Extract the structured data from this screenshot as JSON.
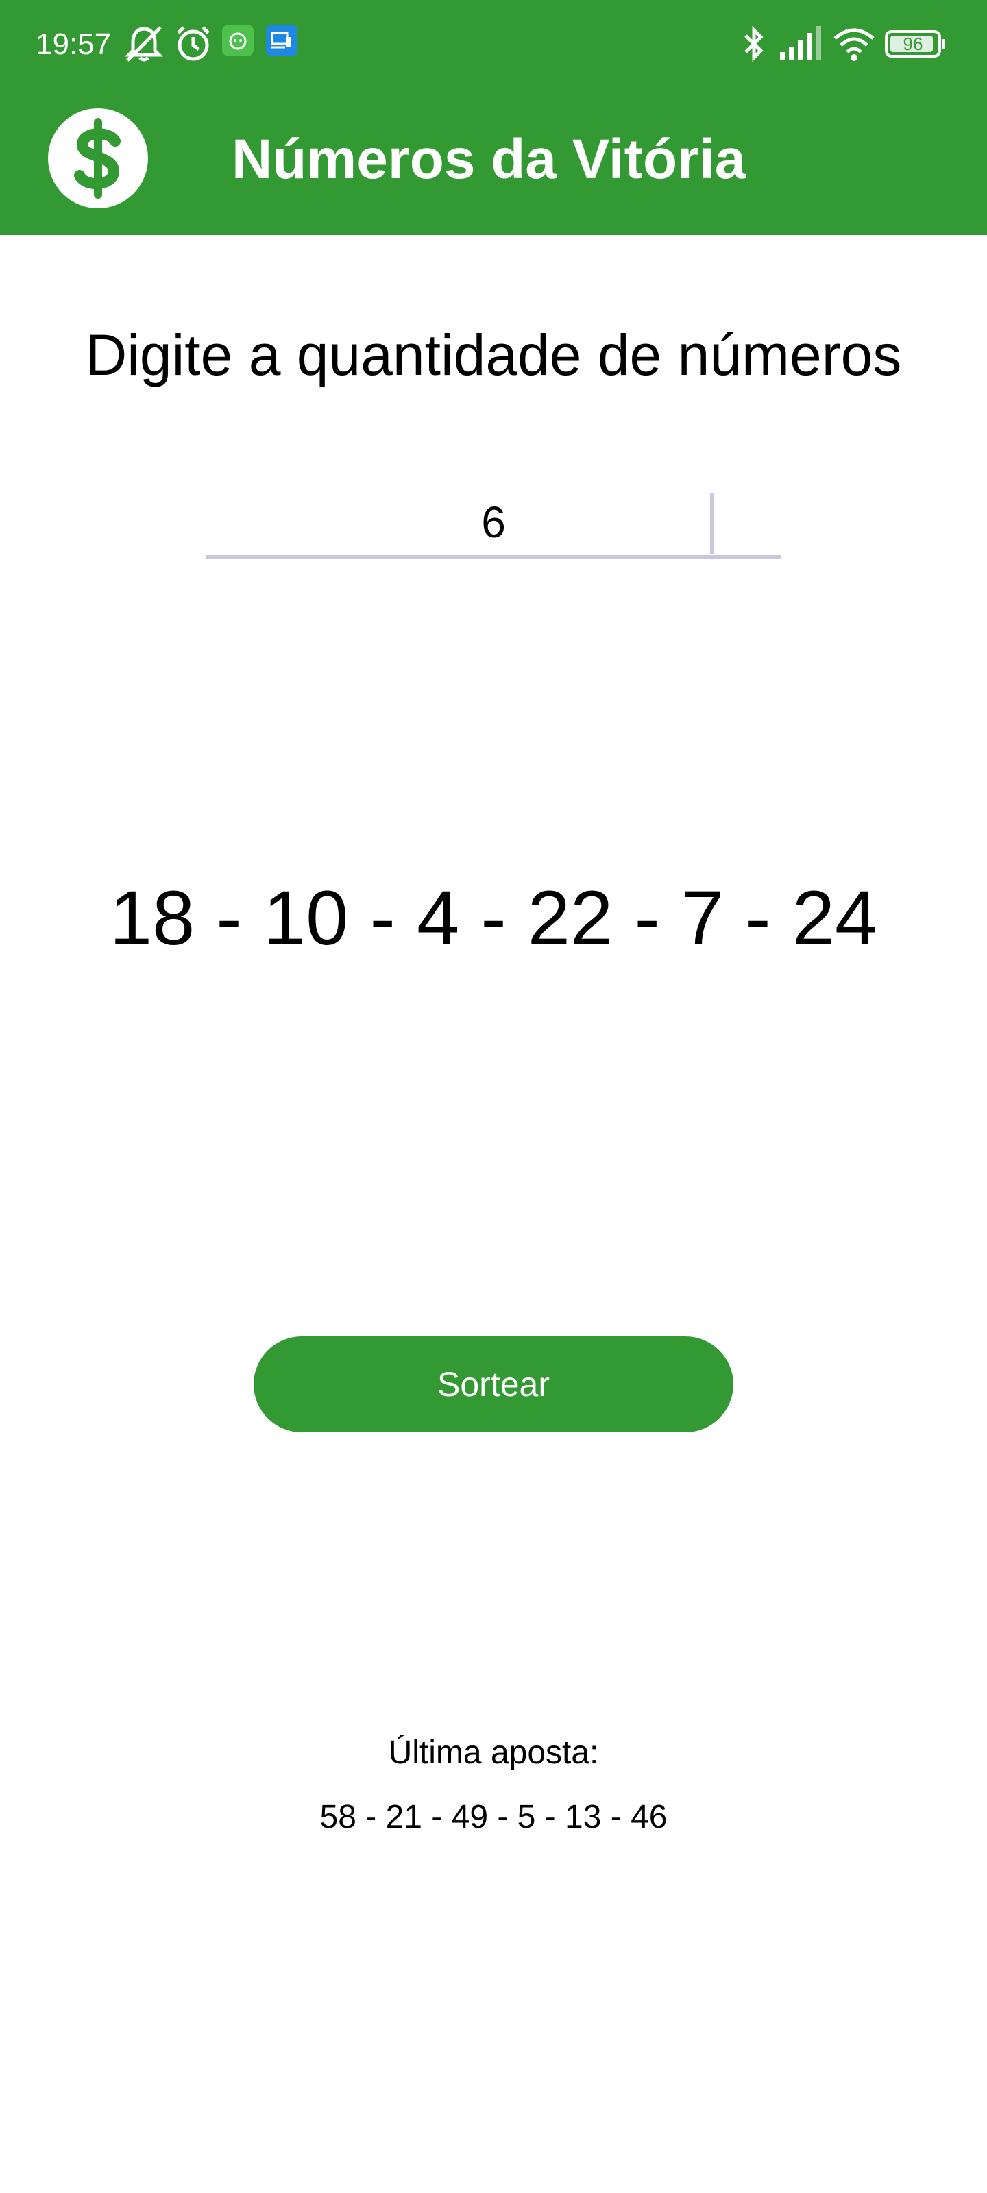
{
  "status_bar": {
    "time": "19:57",
    "battery": "96",
    "icons": [
      "notifications-off-icon",
      "alarm-icon",
      "app-notification-icon",
      "screen-cast-icon",
      "bluetooth-icon",
      "signal-icon",
      "wifi-icon",
      "battery-icon"
    ]
  },
  "app_bar": {
    "title": "Números da Vitória",
    "logo_icon": "dollar-sign-icon",
    "color": "#339933"
  },
  "main": {
    "prompt": "Digite a quantidade de números",
    "quantity_value": "6",
    "result": "18 - 10 - 4 - 22 - 7 - 24",
    "draw_button_label": "Sortear"
  },
  "last_bet": {
    "label": "Última aposta:",
    "values": "58 - 21 - 49 - 5 - 13 - 46"
  }
}
